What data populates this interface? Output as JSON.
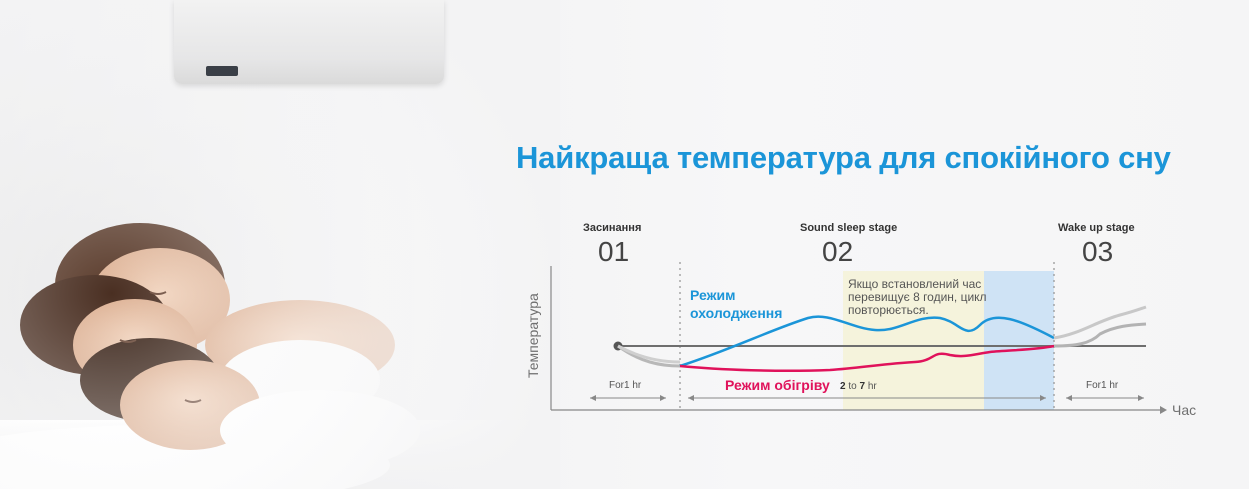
{
  "headline": "Найкраща температура для спокійного сну",
  "stages": [
    {
      "label": "Засинання",
      "number": "01"
    },
    {
      "label": "Sound sleep stage",
      "number": "02"
    },
    {
      "label": "Wake up stage",
      "number": "03"
    }
  ],
  "y_axis_label": "Температура",
  "x_axis_label": "Час",
  "cooling_label": "Режим охолодження",
  "heating_label": "Режим обігріву",
  "note": "Якщо встановлений час перевищує 8 годин, цикл повторюється.",
  "durations": {
    "first": "For1 hr",
    "middle_a": "2",
    "middle_to": "to",
    "middle_b": "7",
    "middle_unit": "hr",
    "last": "For1 hr"
  },
  "colors": {
    "headline": "#1b95d8",
    "cooling": "#1b95d8",
    "heating": "#e0125b",
    "grey_line": "#6e6e6e",
    "stage2_highlight": "#f5f3dc",
    "stage2_blue": "#cfe3f5"
  }
}
